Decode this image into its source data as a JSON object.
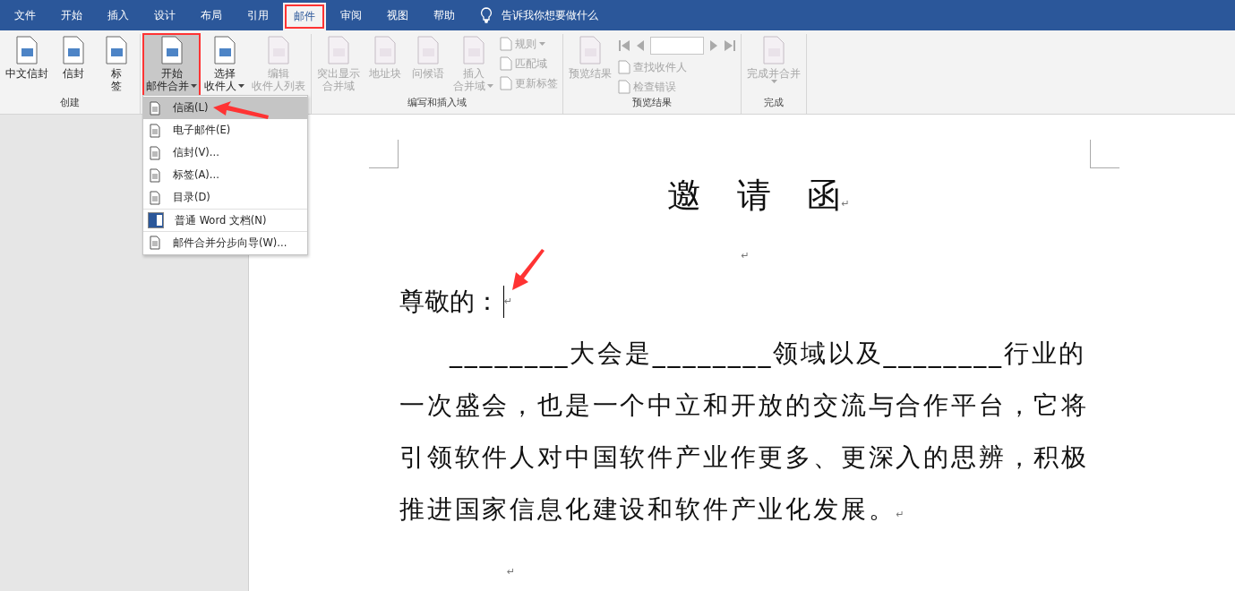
{
  "menu_tabs": [
    {
      "label": "文件",
      "selected": false
    },
    {
      "label": "开始",
      "selected": false
    },
    {
      "label": "插入",
      "selected": false
    },
    {
      "label": "设计",
      "selected": false
    },
    {
      "label": "布局",
      "selected": false
    },
    {
      "label": "引用",
      "selected": false
    },
    {
      "label": "邮件",
      "selected": true
    },
    {
      "label": "审阅",
      "selected": false
    },
    {
      "label": "视图",
      "selected": false
    },
    {
      "label": "帮助",
      "selected": false
    }
  ],
  "tell_me": {
    "placeholder": "告诉我你想要做什么"
  },
  "ribbon_groups": [
    {
      "label": "创建",
      "items": [
        {
          "kind": "large",
          "lines": [
            "中文信封"
          ],
          "disabled": false,
          "dropdown": false,
          "pressed": false
        },
        {
          "kind": "large",
          "lines": [
            "信封"
          ],
          "disabled": false,
          "dropdown": false,
          "pressed": false
        },
        {
          "kind": "large",
          "lines": [
            "标",
            "签"
          ],
          "disabled": false,
          "dropdown": false,
          "pressed": false
        }
      ]
    },
    {
      "items": [
        {
          "kind": "large",
          "lines": [
            "开始",
            "邮件合并"
          ],
          "disabled": false,
          "dropdown": true,
          "pressed": true
        },
        {
          "kind": "large",
          "lines": [
            "选择",
            "收件人"
          ],
          "disabled": false,
          "dropdown": true,
          "pressed": false
        },
        {
          "kind": "large",
          "lines": [
            "编辑",
            "收件人列表"
          ],
          "disabled": true,
          "dropdown": false,
          "pressed": false
        }
      ]
    },
    {
      "label": "编写和插入域",
      "items": [
        {
          "kind": "large",
          "lines": [
            "突出显示",
            "合并域"
          ],
          "disabled": true,
          "dropdown": false,
          "pressed": false
        },
        {
          "kind": "large",
          "lines": [
            "地址块"
          ],
          "disabled": true,
          "dropdown": false,
          "pressed": false
        },
        {
          "kind": "large",
          "lines": [
            "问候语"
          ],
          "disabled": true,
          "dropdown": false,
          "pressed": false
        },
        {
          "kind": "large",
          "lines": [
            "插入",
            "合并域"
          ],
          "disabled": true,
          "dropdown": true,
          "pressed": false
        },
        {
          "kind": "small",
          "rows": [
            {
              "label": "规则",
              "disabled": true,
              "dropdown": true
            },
            {
              "label": "匹配域",
              "disabled": true,
              "dropdown": false
            },
            {
              "label": "更新标签",
              "disabled": true,
              "dropdown": false
            }
          ]
        }
      ]
    },
    {
      "label": "预览结果",
      "items": [
        {
          "kind": "large",
          "lines": [
            "预览结果"
          ],
          "disabled": true,
          "dropdown": false,
          "pressed": false
        },
        {
          "kind": "nav",
          "rows": [
            {
              "label": "查找收件人",
              "disabled": true
            },
            {
              "label": "检查错误",
              "disabled": true
            }
          ]
        }
      ]
    },
    {
      "label": "完成",
      "items": [
        {
          "kind": "large",
          "lines": [
            "完成并合并"
          ],
          "disabled": true,
          "dropdown": true,
          "pressed": false
        }
      ]
    }
  ],
  "start_menu": [
    {
      "label": "信函(L)",
      "selected": true,
      "divider_before": false
    },
    {
      "label": "电子邮件(E)",
      "selected": false,
      "divider_before": false
    },
    {
      "label": "信封(V)...",
      "selected": false,
      "divider_before": false
    },
    {
      "label": "标签(A)...",
      "selected": false,
      "divider_before": false
    },
    {
      "label": "目录(D)",
      "selected": false,
      "divider_before": false
    },
    {
      "label": "普通 Word 文档(N)",
      "selected": false,
      "divider_before": true
    },
    {
      "label": "邮件合并分步向导(W)...",
      "selected": false,
      "divider_before": true
    }
  ],
  "document": {
    "paragraphs": [
      {
        "kind": "title",
        "text": "邀 请 函",
        "mark": "↵"
      },
      {
        "kind": "empty_center",
        "mark": "↵"
      },
      {
        "kind": "salutation",
        "text": "尊敬的：",
        "mark": "↵",
        "cursor": true
      },
      {
        "kind": "body",
        "text": "________大会是________领域以及________行业的一次盛会，也是一个中立和开放的交流与合作平台，它将引领软件人对中国软件产业作更多、更深入的思辨，积极推进国家信息化建设和软件产业化发展。",
        "mark": "↵"
      },
      {
        "kind": "empty_indent",
        "mark": "↵"
      }
    ]
  }
}
